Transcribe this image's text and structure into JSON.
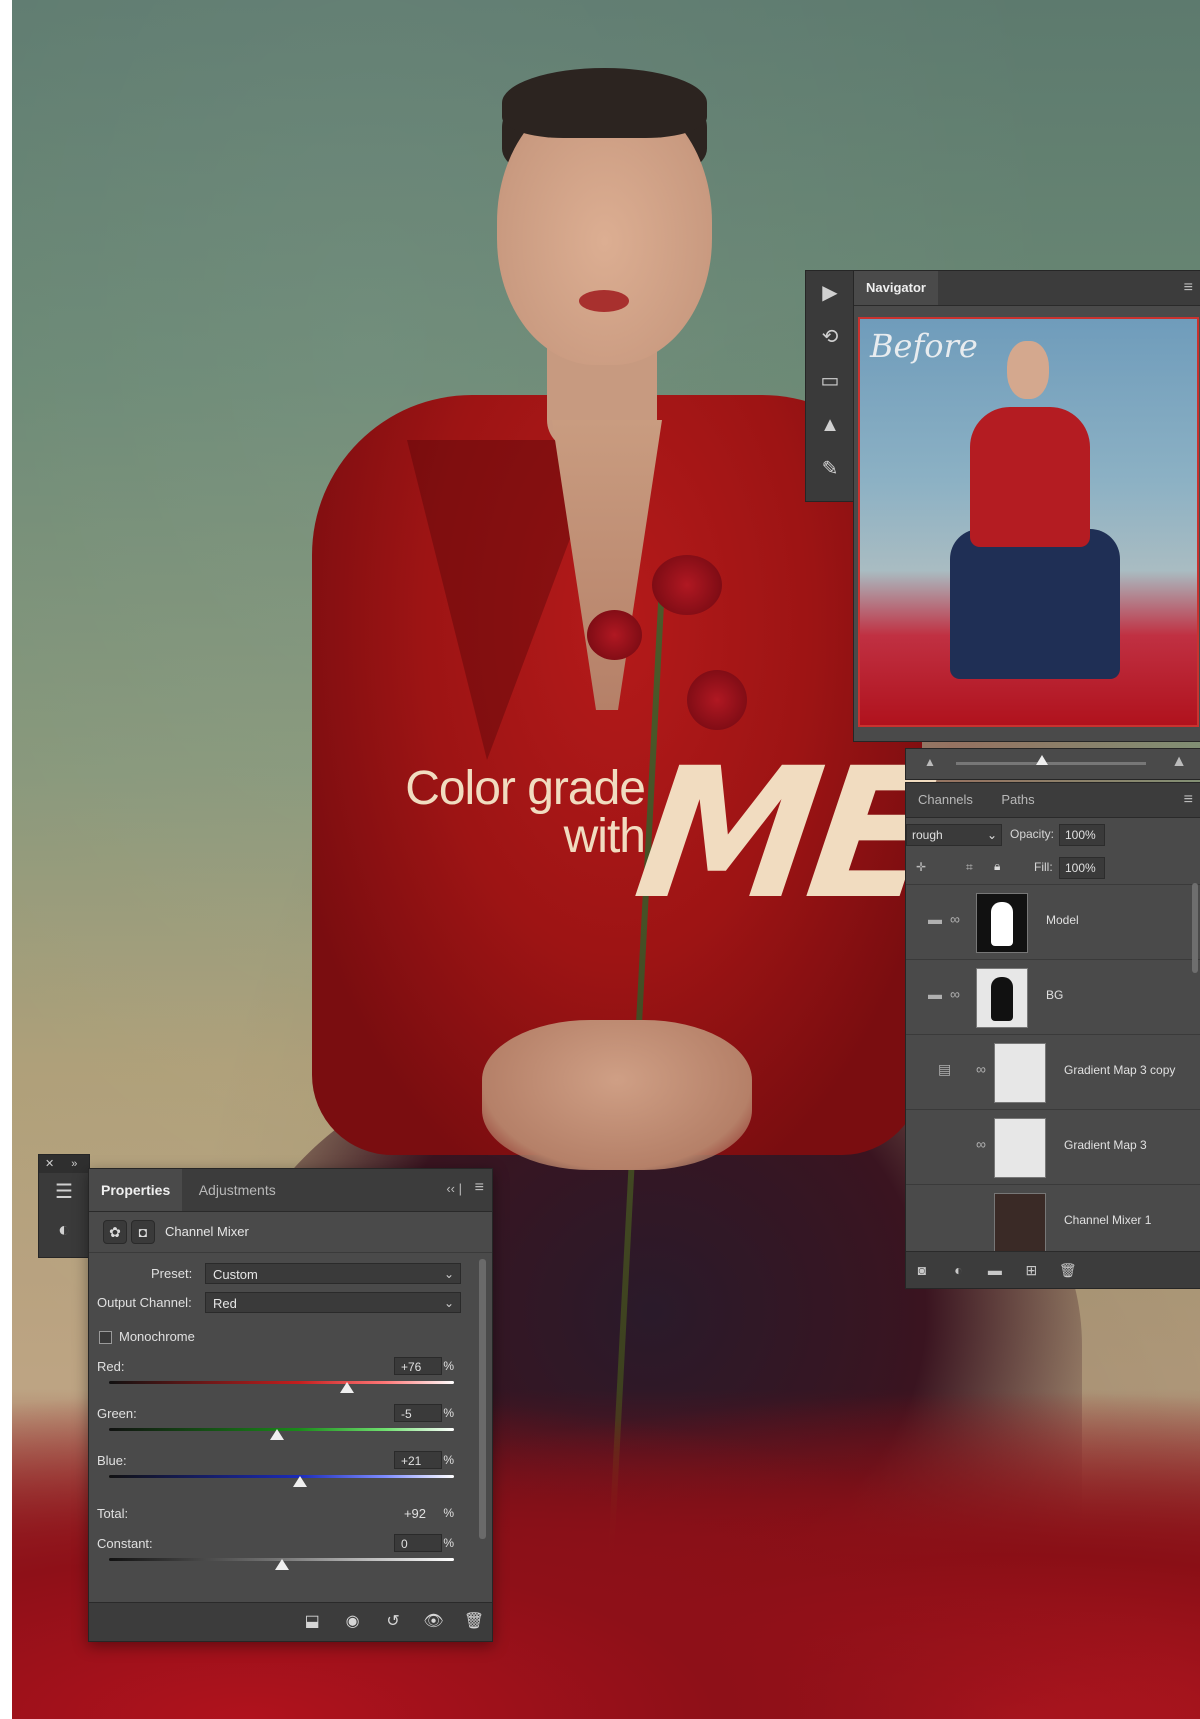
{
  "title": {
    "line1": "Color grade",
    "line2": "with",
    "highlight": "ME"
  },
  "navigator": {
    "tab": "Navigator",
    "preview_label": "Before",
    "toolstrip_icons": [
      "play-icon",
      "history-icon",
      "comment-icon",
      "histogram-icon",
      "brush-settings-icon"
    ]
  },
  "layers_panel": {
    "tabs": [
      "Channels",
      "Paths"
    ],
    "blend_mode": "rough",
    "opacity_label": "Opacity:",
    "opacity_value": "100%",
    "fill_label": "Fill:",
    "fill_value": "100%",
    "layers": [
      {
        "name": "Model",
        "type": "group",
        "thumb": "mask-white"
      },
      {
        "name": "BG",
        "type": "group",
        "thumb": "mask-black"
      },
      {
        "name": "Gradient Map 3 copy",
        "type": "adjustment",
        "thumb": "light"
      },
      {
        "name": "Gradient Map 3",
        "type": "adjustment",
        "thumb": "light"
      },
      {
        "name": "Channel Mixer 1",
        "type": "adjustment",
        "thumb": "photo"
      }
    ]
  },
  "properties": {
    "tabs": [
      "Properties",
      "Adjustments"
    ],
    "active_tab": "Properties",
    "adjustment_title": "Channel Mixer",
    "preset_label": "Preset:",
    "preset_value": "Custom",
    "output_label": "Output Channel:",
    "output_value": "Red",
    "monochrome_label": "Monochrome",
    "monochrome_checked": false,
    "sliders": [
      {
        "label": "Red:",
        "value": "+76",
        "unit": "%",
        "numeric": 76,
        "min": -200,
        "max": 200
      },
      {
        "label": "Green:",
        "value": "-5",
        "unit": "%",
        "numeric": -5,
        "min": -200,
        "max": 200
      },
      {
        "label": "Blue:",
        "value": "+21",
        "unit": "%",
        "numeric": 21,
        "min": -200,
        "max": 200
      }
    ],
    "total_label": "Total:",
    "total_value": "+92",
    "total_unit": "%",
    "constant": {
      "label": "Constant:",
      "value": "0",
      "unit": "%",
      "numeric": 0,
      "min": -200,
      "max": 200
    }
  },
  "colors": {
    "panel_bg": "#4a4a4a",
    "panel_header": "#3c3c3c",
    "accent_title": "#f1dcc0",
    "navigator_border": "#c9322f"
  }
}
